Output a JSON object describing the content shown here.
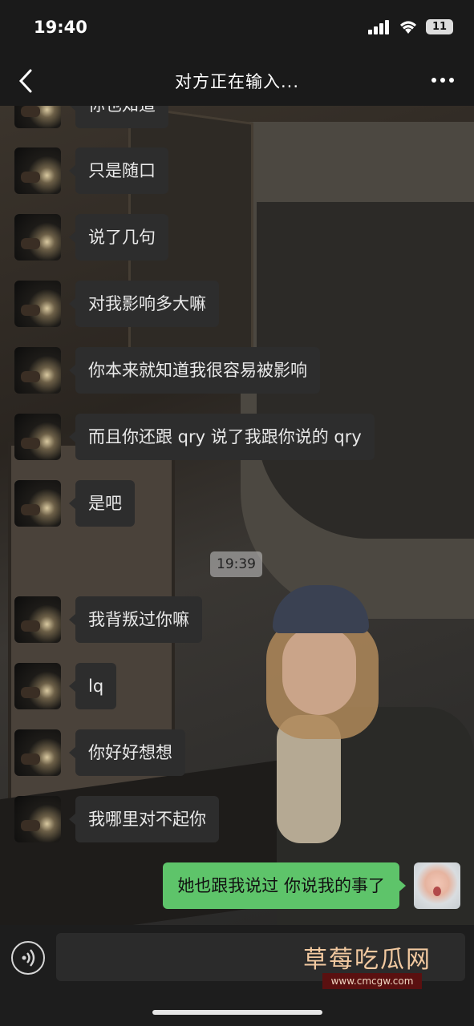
{
  "status_bar": {
    "time": "19:40",
    "battery": "11"
  },
  "nav": {
    "title": "对方正在输入..."
  },
  "chat": {
    "partial_top_message": "你也知道",
    "messages_before_time": [
      "只是随口",
      "说了几句",
      "对我影响多大嘛",
      "你本来就知道我很容易被影响",
      "而且你还跟 qry 说了我跟你说的 qry",
      "是吧"
    ],
    "timestamp": "19:39",
    "messages_after_time": [
      "我背叛过你嘛",
      "lq",
      "你好好想想",
      "我哪里对不起你"
    ],
    "sent_message": "她也跟我说过 你说我的事了"
  },
  "input": {
    "placeholder": ""
  },
  "watermark": {
    "title": "草莓吃瓜网",
    "url": "www.cmcgw.com"
  },
  "colors": {
    "sent_bubble": "#5ec46a",
    "received_bubble": "#2d2d2d",
    "bar_bg": "#1a1a1a"
  }
}
